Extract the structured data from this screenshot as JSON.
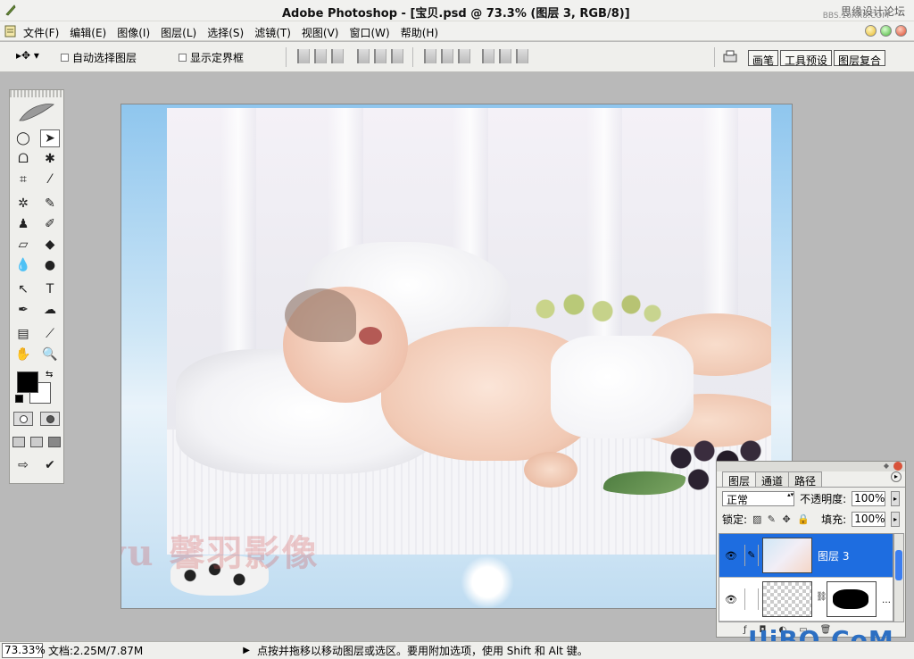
{
  "window": {
    "title": "Adobe Photoshop - [宝贝.psd @ 73.3% (图层 3, RGB/8)]",
    "watermark_site": "思缘设计论坛",
    "watermark_url": "BBS.16XX8.COM"
  },
  "menubar": {
    "items": [
      "文件(F)",
      "编辑(E)",
      "图像(I)",
      "图层(L)",
      "选择(S)",
      "滤镜(T)",
      "视图(V)",
      "窗口(W)",
      "帮助(H)"
    ]
  },
  "options": {
    "auto_select_label": "自动选择图层",
    "show_bounds_label": "显示定界框",
    "palette_well": [
      "画笔",
      "工具预设",
      "图层复合"
    ]
  },
  "canvas": {
    "watermark_text": "Xinyu 馨羽影像"
  },
  "layers_panel": {
    "tabs": [
      "图层",
      "通道",
      "路径"
    ],
    "blend_mode": "正常",
    "opacity_label": "不透明度:",
    "opacity_value": "100%",
    "lock_label": "锁定:",
    "fill_label": "填充:",
    "fill_value": "100%",
    "layers": [
      {
        "name": "图层 3",
        "selected": true
      },
      {
        "name": "",
        "selected": false
      }
    ]
  },
  "statusbar": {
    "zoom": "73.33%",
    "doc_info": "文档:2.25M/7.87M",
    "hint": "点按并拖移以移动图层或选区。要用附加选项，使用 Shift 和 Alt 键。"
  },
  "site_watermark": "UiBQ.CoM",
  "colors": {
    "foreground": "#000000",
    "background": "#ffffff",
    "selection": "#1e6de0"
  }
}
